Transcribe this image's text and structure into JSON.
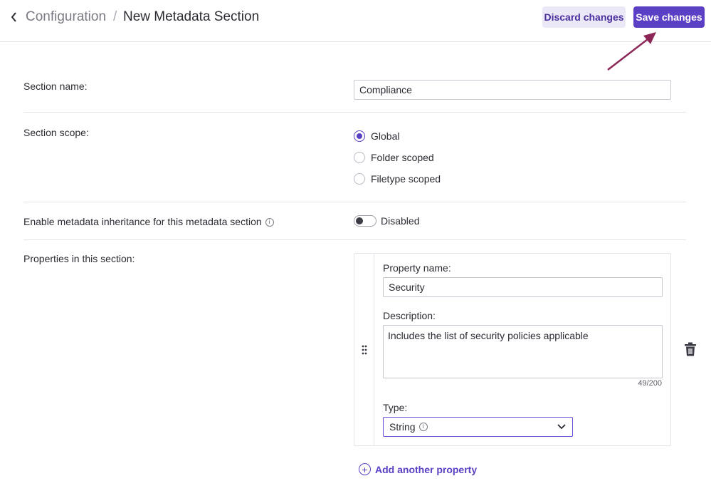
{
  "header": {
    "breadcrumb_parent": "Configuration",
    "breadcrumb_separator": "/",
    "page_title": "New Metadata Section",
    "discard_label": "Discard changes",
    "save_label": "Save changes"
  },
  "form": {
    "section_name": {
      "label": "Section name:",
      "value": "Compliance"
    },
    "section_scope": {
      "label": "Section scope:",
      "options": [
        {
          "label": "Global",
          "checked": true
        },
        {
          "label": "Folder scoped",
          "checked": false
        },
        {
          "label": "Filetype scoped",
          "checked": false
        }
      ]
    },
    "inheritance": {
      "label": "Enable metadata inheritance for this metadata section",
      "info_icon": "info-icon",
      "status": "Disabled",
      "enabled": false
    },
    "properties": {
      "label": "Properties in this section:",
      "items": [
        {
          "name_label": "Property name:",
          "name_value": "Security",
          "description_label": "Description:",
          "description_value": "Includes the list of security policies applicable",
          "char_count": "49/200",
          "type_label": "Type:",
          "type_value": "String"
        }
      ],
      "add_label": "Add another property"
    }
  },
  "colors": {
    "accent": "#5b3fc4",
    "annotation_arrow": "#8b2657"
  }
}
